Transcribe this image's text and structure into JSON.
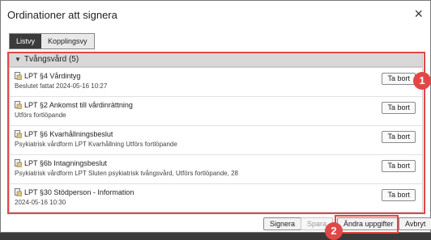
{
  "dialog": {
    "title": "Ordinationer att signera",
    "close_glyph": "×"
  },
  "tabs": [
    {
      "label": "Listvy",
      "active": true
    },
    {
      "label": "Kopplingsvy",
      "active": false
    }
  ],
  "group": {
    "title": "Tvångsvård (5)"
  },
  "items": [
    {
      "title": "LPT §4 Vårdintyg",
      "subtitle": "Beslutet fattat 2024-05-16 10:27",
      "button": "Ta bort"
    },
    {
      "title": "LPT §2 Ankomst till vårdinrättning",
      "subtitle": "Utförs fortlöpande",
      "button": "Ta bort"
    },
    {
      "title": "LPT §6 Kvarhållningsbeslut",
      "subtitle": "Psykiatrisk vårdform LPT Kvarhållning Utförs fortlöpande",
      "button": "Ta bort"
    },
    {
      "title": "LPT §6b Intagningsbeslut",
      "subtitle": "Psykiatrisk vårdform LPT Sluten psykiatrisk tvångsvård, Utförs fortlöpande, 28",
      "button": "Ta bort"
    },
    {
      "title": "LPT §30 Stödperson - Information",
      "subtitle": "2024-05-16 10:30",
      "button": "Ta bort"
    }
  ],
  "footer": {
    "sign": "Signera",
    "save": "Spara",
    "change": "Ändra uppgifter",
    "cancel": "Avbryt"
  },
  "annotations": {
    "badge1": "1",
    "badge2": "2"
  },
  "colors": {
    "highlight": "#e04848",
    "active_tab": "#3b3b3b"
  }
}
